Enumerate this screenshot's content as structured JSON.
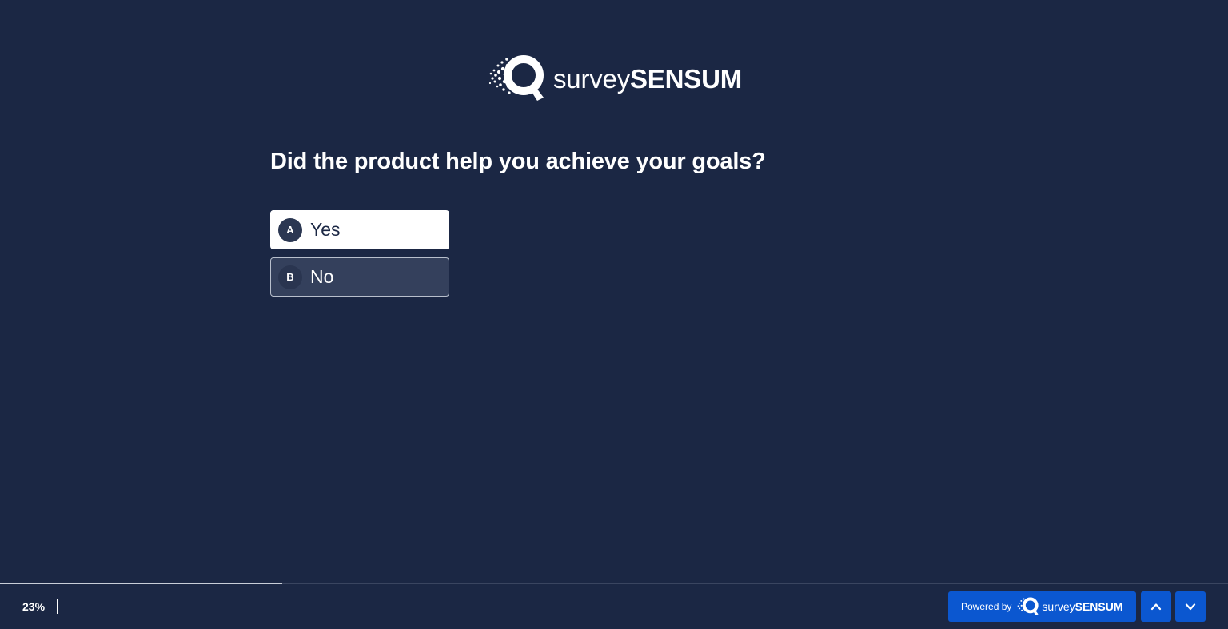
{
  "brand": {
    "name_light": "survey",
    "name_bold": "SENSUM"
  },
  "question": {
    "text": "Did the product help you achieve your goals?",
    "options": [
      {
        "key": "A",
        "label": "Yes",
        "selected": true
      },
      {
        "key": "B",
        "label": "No",
        "selected": false
      }
    ]
  },
  "footer": {
    "progress_label": "23%",
    "progress_fraction": 0.23,
    "powered_by_label": "Powered by",
    "powered_brand_light": "survey",
    "powered_brand_bold": "SENSUM",
    "up_icon": "chevron-up-icon",
    "down_icon": "chevron-down-icon"
  },
  "colors": {
    "background": "#1b2744",
    "accent": "#0b57d0",
    "selected_option_bg": "#ffffff",
    "unselected_option_bg": "#34405c"
  }
}
